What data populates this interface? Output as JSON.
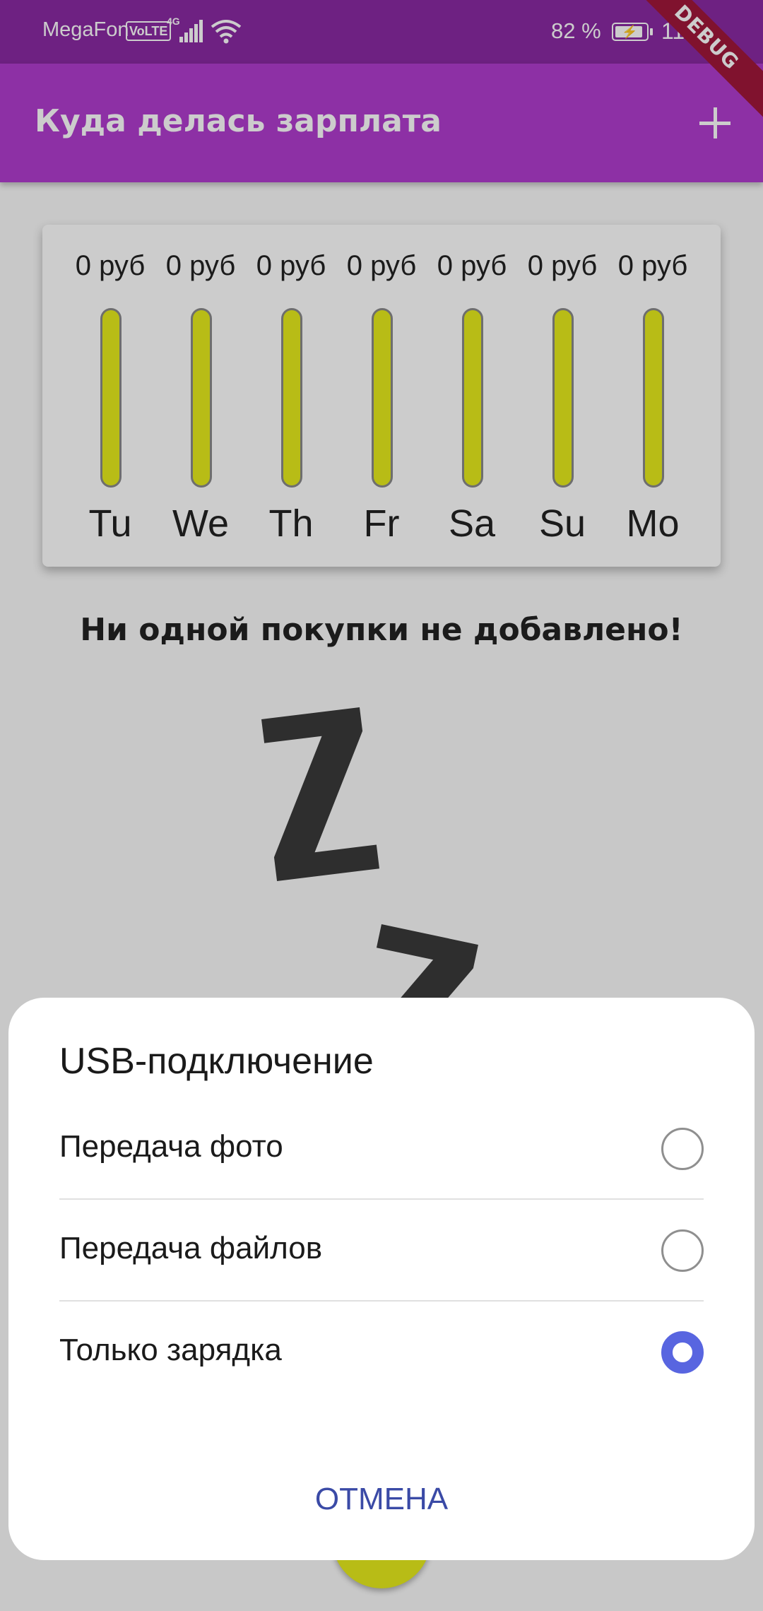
{
  "status_bar": {
    "carrier": "MegaFon",
    "volte": "VoLTE",
    "network": "4G",
    "battery_percent": "82 %",
    "time": "11:01",
    "icons": [
      "signal-icon",
      "wifi-icon",
      "battery-charging-icon"
    ]
  },
  "debug_banner": "DEBUG",
  "app_bar": {
    "title": "Куда делась зарплата",
    "add_icon": "plus-icon"
  },
  "chart_data": {
    "type": "bar",
    "categories": [
      "Tu",
      "We",
      "Th",
      "Fr",
      "Sa",
      "Su",
      "Mo"
    ],
    "values": [
      0,
      0,
      0,
      0,
      0,
      0,
      0
    ],
    "value_labels": [
      "0 руб",
      "0 руб",
      "0 руб",
      "0 руб",
      "0 руб",
      "0 руб",
      "0 руб"
    ]
  },
  "empty_state": {
    "message": "Ни одной покупки не добавлено!",
    "illustration": "zz-sleep-illustration"
  },
  "dialog": {
    "title": "USB-подключение",
    "options": [
      {
        "label": "Передача фото",
        "selected": false
      },
      {
        "label": "Передача файлов",
        "selected": false
      },
      {
        "label": "Только зарядка",
        "selected": true
      }
    ],
    "cancel_label": "ОТМЕНА"
  },
  "colors": {
    "primary": "#b13ccf",
    "primary_dark": "#8a2aa3",
    "bar_fill": "#e6ec1c",
    "radio_accent": "#5865e0",
    "cancel_text": "#3a4aa6",
    "debug_banner": "#a0173a"
  }
}
